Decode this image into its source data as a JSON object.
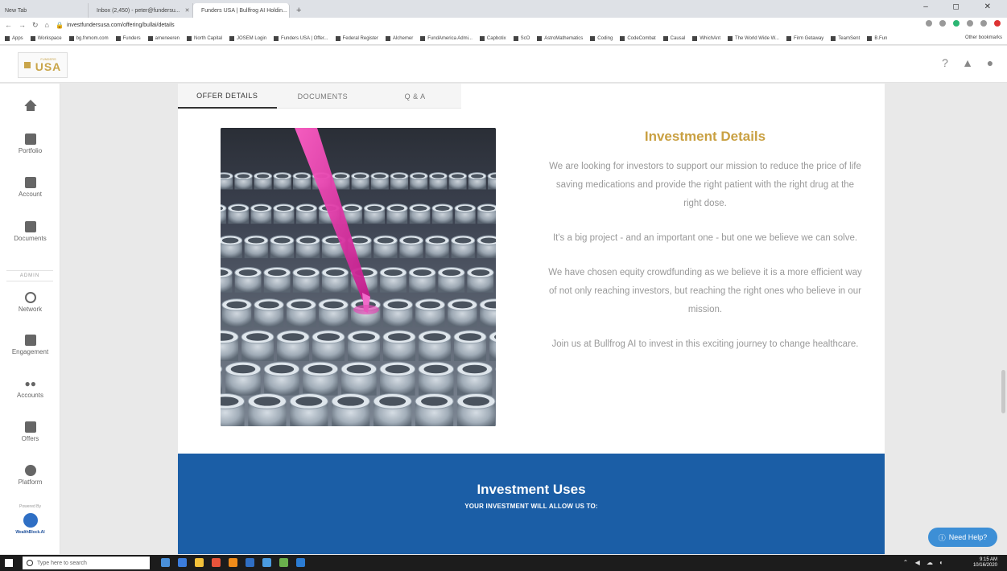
{
  "browser": {
    "tabs": [
      {
        "label": "New Tab",
        "active": false
      },
      {
        "label": "Inbox (2,450) - peter@fundersu...",
        "active": false
      },
      {
        "label": "Funders USA | Bullfrog AI Holdin...",
        "active": true
      }
    ],
    "new_tab": "+",
    "window_controls": "–  ◻  ✕",
    "url": "investfundersusa.com/offering/bullai/details",
    "bookmarks": [
      "Apps",
      "Workspace",
      "bg.fnrnom.com",
      "Funders",
      "ameneeren",
      "North Capital",
      "JOSEM Login",
      "Funders USA | Offer...",
      "Federal Register",
      "Alchemer",
      "FundAmerica Admi...",
      "Capbotix",
      "ScO",
      "AstroMathematics",
      "Coding",
      "CodeCombat",
      "Causal",
      "WhichAnt",
      "The World Wide W...",
      "Firm Getaway",
      "TeamSent",
      "B.Fun"
    ],
    "bookmarks_right": "Other bookmarks"
  },
  "header": {
    "logo_small": "FUNDERS",
    "logo_word": "USA"
  },
  "sidebar": {
    "items": [
      {
        "label": "",
        "icon": "home-icon"
      },
      {
        "label": "Portfolio",
        "icon": "portfolio-icon"
      },
      {
        "label": "Account",
        "icon": "account-icon"
      },
      {
        "label": "Documents",
        "icon": "folder-icon"
      },
      {
        "label": "Network",
        "icon": "globe-icon"
      },
      {
        "label": "Engagement",
        "icon": "chart-icon"
      },
      {
        "label": "Accounts",
        "icon": "people-icon"
      },
      {
        "label": "Offers",
        "icon": "building-icon"
      },
      {
        "label": "Platform",
        "icon": "gear-icon"
      }
    ],
    "admin_label": "ADMIN",
    "powered_by": "Powered By",
    "powered_brand": "WealthBlock.AI"
  },
  "content_tabs": [
    {
      "label": "OFFER DETAILS",
      "active": true
    },
    {
      "label": "DOCUMENTS",
      "active": false
    },
    {
      "label": "Q & A",
      "active": false
    }
  ],
  "details": {
    "title": "Investment Details",
    "paragraphs": [
      "We are looking for investors to support our mission to reduce the price of life saving medications and provide the right patient with the right drug at the right dose.",
      "It's a big project - and an important one - but one we believe we can solve.",
      "We have chosen equity crowdfunding as we believe it is a more efficient way of not only reaching investors, but reaching the right ones who believe in our mission.",
      "Join us at Bullfrog AI to invest in this exciting journey to change healthcare."
    ]
  },
  "uses": {
    "title": "Investment Uses",
    "subtitle": "YOUR INVESTMENT WILL ALLOW US TO:"
  },
  "help": {
    "label": "Need Help?"
  },
  "taskbar": {
    "search_placeholder": "Type here to search",
    "time": "9:15 AM",
    "date": "10/16/2020"
  },
  "colors": {
    "gold": "#c9a042",
    "band_blue": "#1b5ea6",
    "help_blue": "#3d8fd6"
  }
}
